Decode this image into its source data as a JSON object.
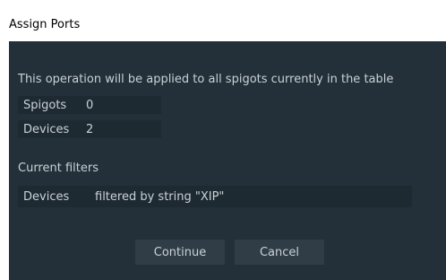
{
  "window": {
    "title": "Assign Ports"
  },
  "dialog": {
    "message": "This operation will be applied to all spigots currently in the table",
    "counts": [
      {
        "label": "Spigots",
        "value": "0"
      },
      {
        "label": "Devices",
        "value": "2"
      }
    ],
    "filters_heading": "Current filters",
    "filters": [
      {
        "label": "Devices",
        "value": "filtered by string \"XIP\""
      }
    ]
  },
  "buttons": {
    "continue_label": "Continue",
    "cancel_label": "Cancel"
  },
  "colors": {
    "dialog_background": "#233039",
    "row_background": "#1e2a32",
    "button_background": "#303d47",
    "text": "#c9d1d6"
  }
}
